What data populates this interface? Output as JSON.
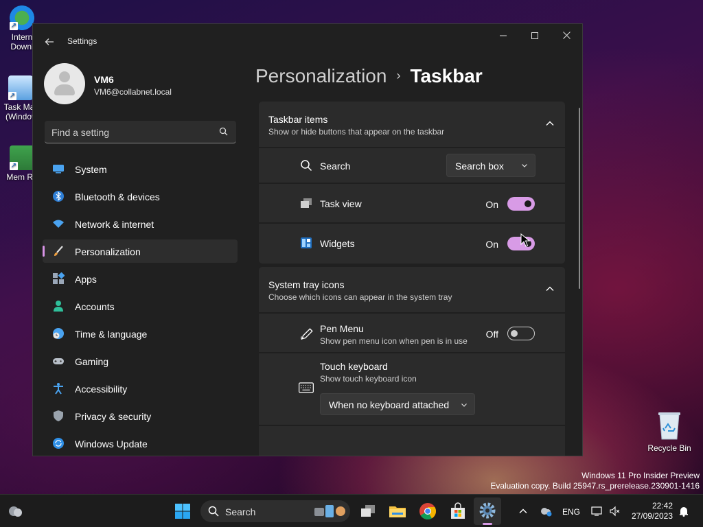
{
  "desktop": {
    "icons": [
      {
        "label": "Intern Downl"
      },
      {
        "label": "Task Mar (Windov"
      },
      {
        "label": "Mem Re"
      }
    ],
    "recycle_bin": "Recycle Bin",
    "watermark_line1": "Windows 11 Pro Insider Preview",
    "watermark_line2": "Evaluation copy. Build 25947.rs_prerelease.230901-1416"
  },
  "window": {
    "title": "Settings",
    "back_icon": "back-arrow-icon",
    "controls": [
      "minimize",
      "maximize",
      "close"
    ]
  },
  "profile": {
    "name": "VM6",
    "email": "VM6@collabnet.local"
  },
  "search": {
    "placeholder": "Find a setting"
  },
  "nav": {
    "items": [
      {
        "label": "System",
        "icon": "system-icon"
      },
      {
        "label": "Bluetooth & devices",
        "icon": "bluetooth-icon"
      },
      {
        "label": "Network & internet",
        "icon": "wifi-icon"
      },
      {
        "label": "Personalization",
        "icon": "brush-icon",
        "active": true
      },
      {
        "label": "Apps",
        "icon": "apps-icon"
      },
      {
        "label": "Accounts",
        "icon": "accounts-icon"
      },
      {
        "label": "Time & language",
        "icon": "time-language-icon"
      },
      {
        "label": "Gaming",
        "icon": "gaming-icon"
      },
      {
        "label": "Accessibility",
        "icon": "accessibility-icon"
      },
      {
        "label": "Privacy & security",
        "icon": "shield-icon"
      },
      {
        "label": "Windows Update",
        "icon": "update-icon"
      }
    ]
  },
  "breadcrumb": {
    "parent": "Personalization",
    "separator": "›",
    "current": "Taskbar"
  },
  "taskbar_items": {
    "title": "Taskbar items",
    "subtitle": "Show or hide buttons that appear on the taskbar",
    "search": {
      "label": "Search",
      "value": "Search box"
    },
    "task_view": {
      "label": "Task view",
      "state": "On"
    },
    "widgets": {
      "label": "Widgets",
      "state": "On"
    }
  },
  "system_tray": {
    "title": "System tray icons",
    "subtitle": "Choose which icons can appear in the system tray",
    "pen_menu": {
      "label": "Pen Menu",
      "sub": "Show pen menu icon when pen is in use",
      "state": "Off"
    },
    "touch_keyboard": {
      "label": "Touch keyboard",
      "sub": "Show touch keyboard icon",
      "value": "When no keyboard attached"
    }
  },
  "taskbar": {
    "search_label": "Search",
    "language": "ENG",
    "time": "22:42",
    "date": "27/09/2023"
  },
  "colors": {
    "accent": "#d89be6",
    "window_bg": "#202020",
    "card_bg": "#2b2b2b"
  }
}
